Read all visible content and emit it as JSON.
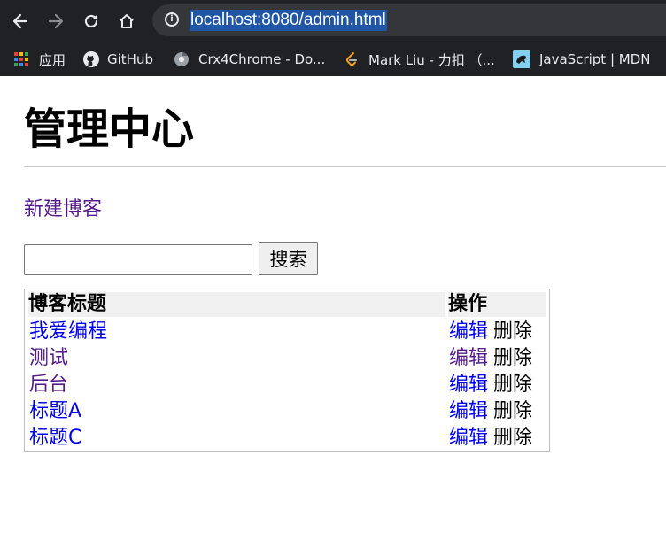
{
  "browser": {
    "url": "localhost:8080/admin.html",
    "bookmarks": [
      {
        "label": "应用",
        "icon": "apps-grid-icon"
      },
      {
        "label": "GitHub",
        "icon": "github-icon"
      },
      {
        "label": "Crx4Chrome - Do...",
        "icon": "crx4chrome-icon"
      },
      {
        "label": "Mark Liu - 力扣 （...",
        "icon": "leetcode-icon"
      },
      {
        "label": "JavaScript | MDN",
        "icon": "mdn-icon"
      }
    ]
  },
  "page": {
    "title": "管理中心",
    "new_blog_link": "新建博客",
    "search": {
      "value": "",
      "button_label": "搜索"
    },
    "table": {
      "headers": [
        "博客标题",
        "操作"
      ],
      "rows": [
        {
          "title": "我爱编程",
          "edit": "编辑",
          "delete": "删除",
          "title_color": "#0000ee",
          "edit_color": "#0000ee"
        },
        {
          "title": "测试",
          "edit": "编辑",
          "delete": "删除",
          "title_color": "#551a8b",
          "edit_color": "#551a8b"
        },
        {
          "title": "后台",
          "edit": "编辑",
          "delete": "删除",
          "title_color": "#551a8b",
          "edit_color": "#0000ee"
        },
        {
          "title": "标题A",
          "edit": "编辑",
          "delete": "删除",
          "title_color": "#0000ee",
          "edit_color": "#0000ee"
        },
        {
          "title": "标题C",
          "edit": "编辑",
          "delete": "删除",
          "title_color": "#0000ee",
          "edit_color": "#0000ee"
        }
      ]
    }
  },
  "colors": {
    "chrome_bg": "#202124",
    "omnibox_bg": "#35363a",
    "url_selection": "#1f56a6",
    "link_unvisited": "#0000ee",
    "link_visited": "#551a8b"
  }
}
